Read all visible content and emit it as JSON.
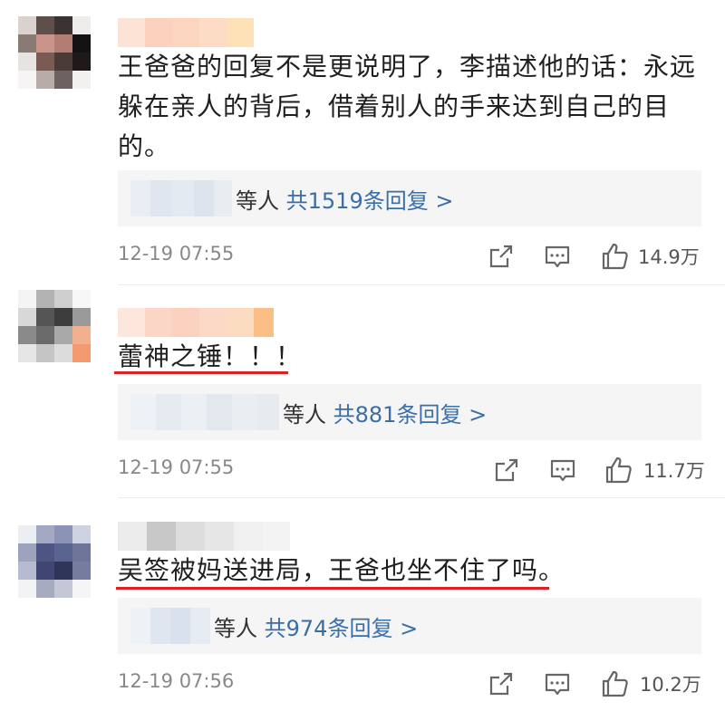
{
  "comments": [
    {
      "text_lines": [
        "王爸爸的回复不是更说明了，李描述他的话：永远",
        "躲在亲人的背后，借着别人的手来达到自己的目",
        "的。"
      ],
      "reply_suffix": "等人",
      "reply_count": "共1519条回复 >",
      "time": "12-19 07:55",
      "likes": "14.9万",
      "underlined": false
    },
    {
      "text_lines": [
        "蕾神之锤！！！"
      ],
      "reply_suffix": "等人",
      "reply_count": "共881条回复 >",
      "time": "12-19 07:55",
      "likes": "11.7万",
      "underlined": true
    },
    {
      "text_lines": [
        "吴签被妈送进局，王爸也坐不住了吗。"
      ],
      "reply_suffix": "等人",
      "reply_count": "共974条回复 >",
      "time": "12-19 07:56",
      "likes": "10.2万",
      "underlined": true
    }
  ],
  "icons": {
    "share": "share-icon",
    "comment": "comment-icon",
    "like": "thumbs-up-icon"
  },
  "colors": {
    "link": "#3a6ea8",
    "underline": "#e02020",
    "reply_bg": "#f5f5f5",
    "meta": "#888888"
  }
}
